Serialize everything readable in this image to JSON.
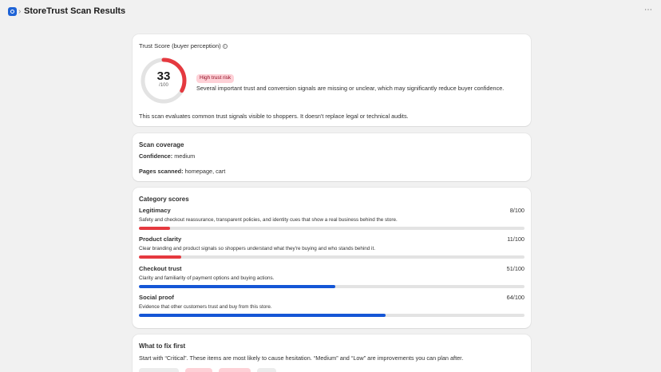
{
  "header": {
    "title": "StoreTrust Scan Results",
    "chevron": "›",
    "more": "⋯"
  },
  "trust": {
    "label": "Trust Score (buyer perception)",
    "info_icon": "info-icon",
    "score": "33",
    "score_value": 33,
    "score_max": "/100",
    "badge": "High trust risk",
    "summary": "Several important trust and conversion signals are missing or unclear, which may significantly reduce buyer confidence.",
    "note": "This scan evaluates common trust signals visible to shoppers. It doesn't replace legal or technical audits."
  },
  "coverage": {
    "title": "Scan coverage",
    "confidence_label": "Confidence:",
    "confidence_value": " medium",
    "pages_label": "Pages scanned:",
    "pages_value": " homepage, cart"
  },
  "categories": {
    "title": "Category scores",
    "items": [
      {
        "name": "Legitimacy",
        "score": "8/100",
        "value": 8,
        "desc": "Safety and checkout reassurance, transparent policies, and identity cues that show a real business behind the store."
      },
      {
        "name": "Product clarity",
        "score": "11/100",
        "value": 11,
        "desc": "Clear branding and product signals so shoppers understand what they're buying and who stands behind it."
      },
      {
        "name": "Checkout trust",
        "score": "51/100",
        "value": 51,
        "desc": "Clarity and familiarity of payment options and buying actions."
      },
      {
        "name": "Social proof",
        "score": "64/100",
        "value": 64,
        "desc": "Evidence that other customers trust and buy from this store."
      }
    ]
  },
  "fix": {
    "title": "What to fix first",
    "desc": "Start with “Critical”. These items are most likely to cause hesitation. “Medium” and “Low” are improvements you can plan after."
  },
  "colors": {
    "danger": "#e5393f",
    "info": "#1556d6",
    "track": "#e3e3e3",
    "badge_bg": "#fed1d7"
  }
}
